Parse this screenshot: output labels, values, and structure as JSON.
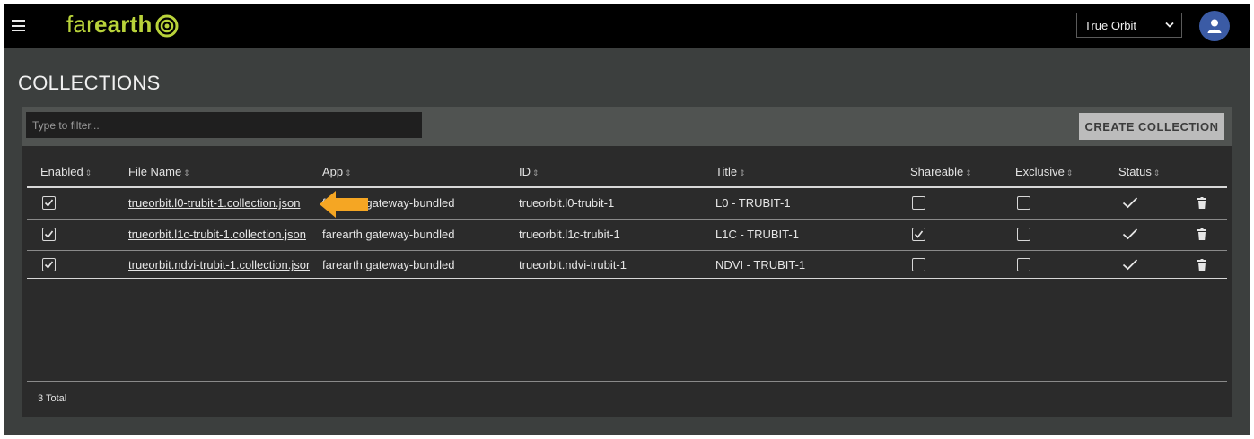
{
  "header": {
    "logo_far": "far",
    "logo_earth": "earth",
    "org_select": "True Orbit",
    "icons": {
      "menu": "hamburger-menu-icon",
      "chevron": "chevron-down-icon",
      "user": "user-icon",
      "logo": "spiral-logo-icon"
    }
  },
  "page": {
    "title": "COLLECTIONS"
  },
  "toolbar": {
    "filter_placeholder": "Type to filter...",
    "create_label": "CREATE COLLECTION"
  },
  "table": {
    "headers": {
      "enabled": "Enabled",
      "file_name": "File Name",
      "app": "App",
      "id": "ID",
      "title": "Title",
      "shareable": "Shareable",
      "exclusive": "Exclusive",
      "status": "Status"
    },
    "rows": [
      {
        "enabled": true,
        "file_name": "trueorbit.l0-trubit-1.collection.json",
        "app": "farearth.gateway-bundled",
        "id": "trueorbit.l0-trubit-1",
        "title": "L0 - TRUBIT-1",
        "shareable": false,
        "exclusive": false,
        "status": "check"
      },
      {
        "enabled": true,
        "file_name": "trueorbit.l1c-trubit-1.collection.json",
        "app": "farearth.gateway-bundled",
        "id": "trueorbit.l1c-trubit-1",
        "title": "L1C - TRUBIT-1",
        "shareable": true,
        "exclusive": false,
        "status": "check"
      },
      {
        "enabled": true,
        "file_name": "trueorbit.ndvi-trubit-1.collection.json",
        "app": "farearth.gateway-bundled",
        "id": "trueorbit.ndvi-trubit-1",
        "title": "NDVI - TRUBIT-1",
        "shareable": false,
        "exclusive": false,
        "status": "check"
      }
    ],
    "total": "3 Total"
  },
  "colors": {
    "brand": "#b9d33a",
    "background": "#3c3f3e",
    "panel": "#2b2b2b",
    "avatar": "#3b5ba5",
    "annotation_arrow": "#f5a623"
  }
}
